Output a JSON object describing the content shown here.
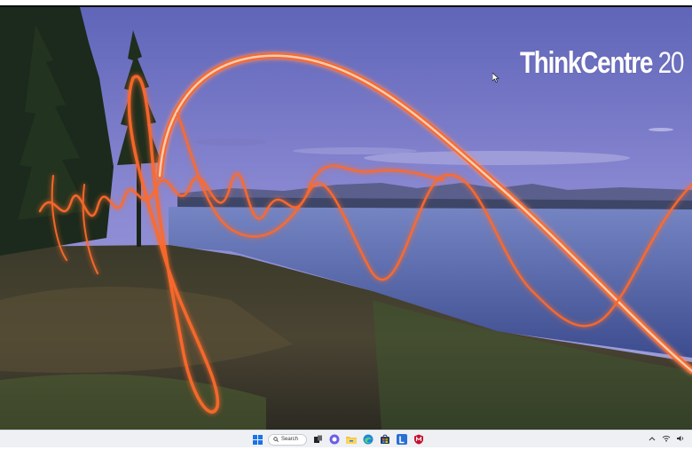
{
  "desktop": {
    "brand_bold": "ThinkCentre",
    "brand_light": "20"
  },
  "taskbar": {
    "search_label": "Search",
    "center_icons": [
      "start-icon",
      "search-icon",
      "task-view-icon",
      "chat-icon",
      "file-explorer-icon",
      "edge-icon",
      "store-icon",
      "lenovo-vantage-icon",
      "mcafee-icon"
    ],
    "tray_icons": [
      "chevron-up-icon",
      "wifi-icon",
      "volume-icon"
    ]
  },
  "colors": {
    "sky_top": "#6f76c4",
    "sky_mid": "#8f8ed6",
    "lake": "#5a6aa8",
    "light_trail": "#ff6a2a",
    "taskbar": "#eef0f4"
  }
}
